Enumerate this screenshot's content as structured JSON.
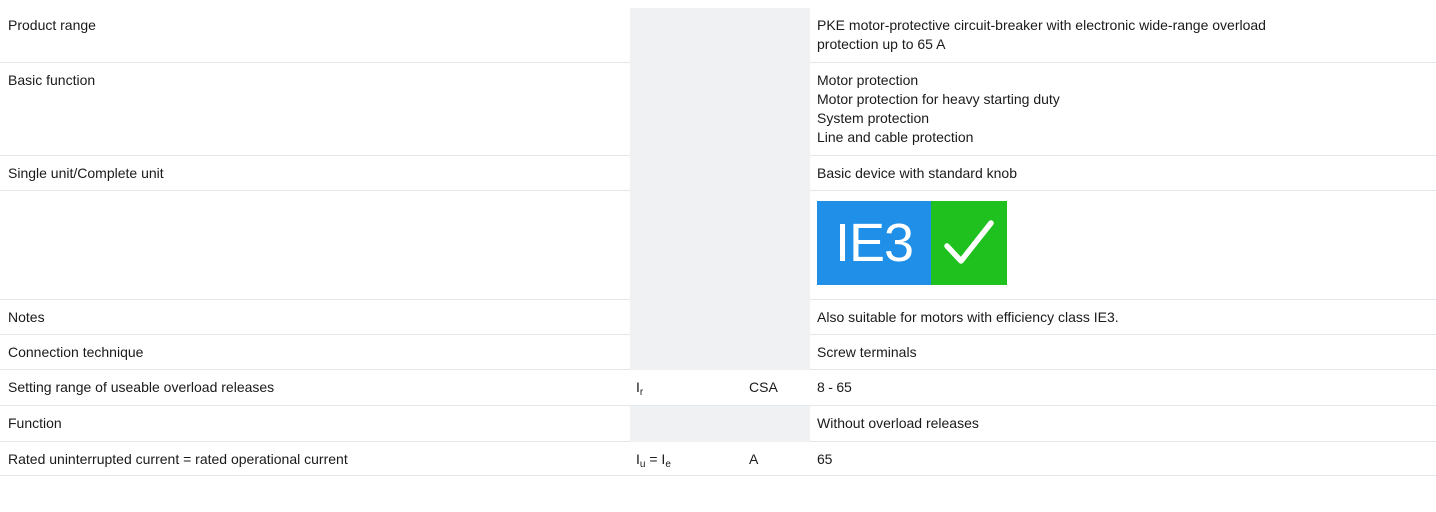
{
  "rows": [
    {
      "label": "Product range",
      "symbol": "",
      "unit": "",
      "value_lines": [
        "PKE motor-protective circuit-breaker with electronic wide-range overload",
        "protection up to 65 A"
      ]
    },
    {
      "label": "Basic function",
      "symbol": "",
      "unit": "",
      "value_lines": [
        "Motor protection",
        "Motor protection for heavy starting duty",
        "System protection",
        "Line and cable protection"
      ]
    },
    {
      "label": "Single unit/Complete unit",
      "symbol": "",
      "unit": "",
      "value_lines": [
        "Basic device with standard knob"
      ]
    },
    {
      "label": "",
      "symbol": "",
      "unit": "",
      "badge": {
        "text": "IE3",
        "icon": "checkmark-icon",
        "left_color": "#1f8fe8",
        "right_color": "#1ec11e"
      }
    },
    {
      "label": "Notes",
      "symbol": "",
      "unit": "",
      "value_lines": [
        "Also suitable for motors with efficiency class IE3."
      ]
    },
    {
      "label": "Connection technique",
      "symbol": "",
      "unit": "",
      "value_lines": [
        "Screw terminals"
      ]
    },
    {
      "label": "Setting range of useable overload releases",
      "symbol_main": "I",
      "symbol_sub": "r",
      "unit": "CSA",
      "value_lines": [
        "8 - 65"
      ]
    },
    {
      "label": "Function",
      "symbol": "",
      "unit": "",
      "value_lines": [
        "Without overload releases"
      ]
    },
    {
      "label": "Rated uninterrupted current = rated operational current",
      "symbol_a_main": "I",
      "symbol_a_sub": "u",
      "symbol_eq": " = ",
      "symbol_b_main": "I",
      "symbol_b_sub": "e",
      "unit": "A",
      "value_lines": [
        "65"
      ]
    }
  ]
}
